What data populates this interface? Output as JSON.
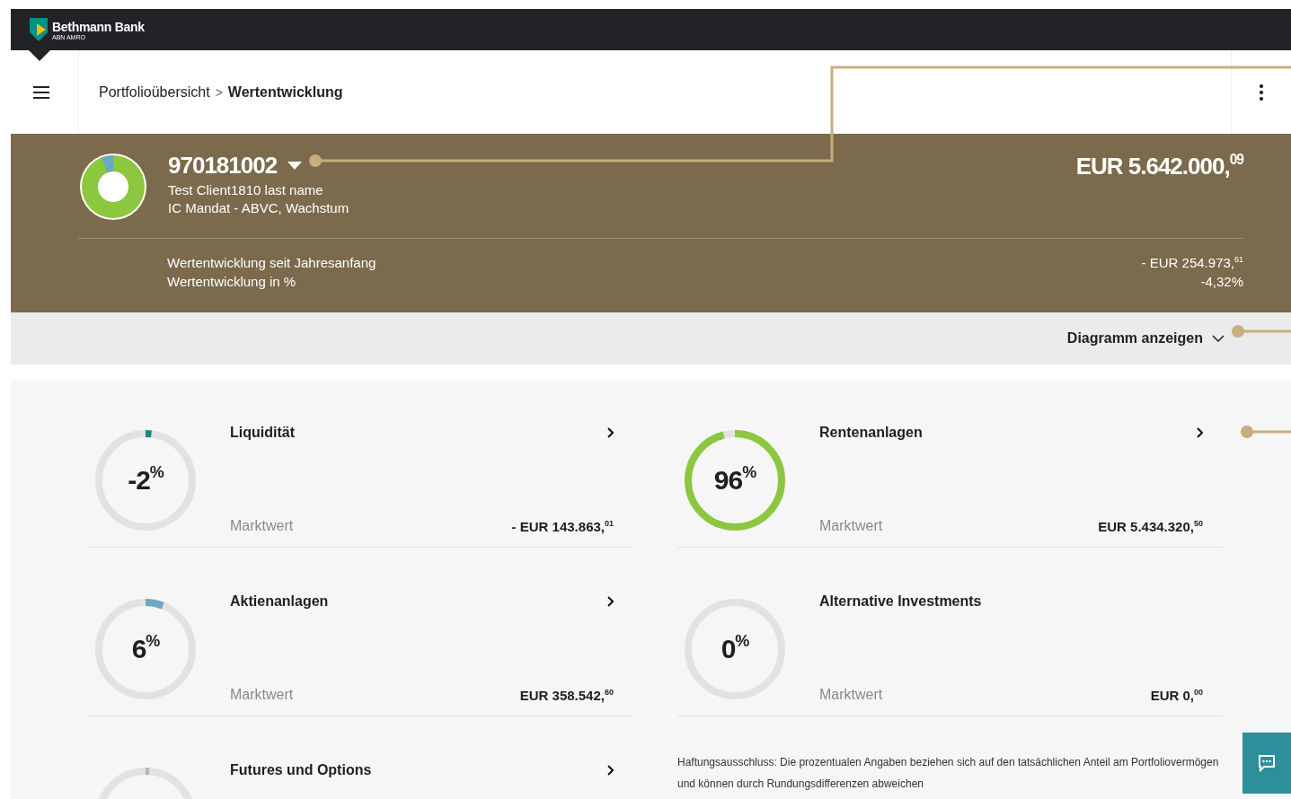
{
  "brand": {
    "name": "Bethmann Bank",
    "subtitle": "ABN AMRO"
  },
  "breadcrumb": [
    {
      "label": "Portfolioübersicht",
      "current": false
    },
    {
      "label": "Wertentwicklung",
      "current": true
    }
  ],
  "breadcrumb_separator": ">",
  "portfolio": {
    "number": "970181002",
    "client": "Test Client1810 last name",
    "mandate": "IC Mandat - ABVC, Wachstum",
    "total": "EUR 5.642.000,$^{09}$",
    "performance": [
      {
        "label": "Wertentwicklung seit Jahresanfang",
        "value": "- EUR 254.973,$^{61}$"
      },
      {
        "label": "Wertentwicklung in %",
        "value": "-4,32%"
      }
    ]
  },
  "chart_toggle": {
    "label": "Diagramm anzeigen",
    "expanded": false
  },
  "categories": [
    {
      "name": "Liquidität",
      "percent": "-2$^{%}$",
      "level": 0.02,
      "color": "#138c7e",
      "label": "Marktwert",
      "value": "- EUR 143.863,$^{01}$",
      "link": true
    },
    {
      "name": "Rentenanlagen",
      "percent": "96$^{%}$",
      "level": 0.96,
      "color": "#8dc63f",
      "label": "Marktwert",
      "value": "EUR 5.434.320,$^{50}$",
      "link": true
    },
    {
      "name": "Aktienanlagen",
      "percent": "6$^{%}$",
      "level": 0.06,
      "color": "#6aa9be",
      "label": "Marktwert",
      "value": "EUR 358.542,$^{60}$",
      "link": true
    },
    {
      "name": "Alternative Investments",
      "percent": "0$^{%}$",
      "level": 0,
      "label": "Marktwert",
      "value": "EUR 0,$^{00}$",
      "link": false
    },
    {
      "name": "Futures und Options",
      "level": 0.012,
      "color": "#b5b5b5",
      "link": true
    }
  ],
  "disclaimer": "Haftungsausschluss: Die prozentualen Angaben beziehen sich auf den tatsächlichen Anteil am Portfoliovermögen und können durch Rundungsdifferenzen abweichen"
}
